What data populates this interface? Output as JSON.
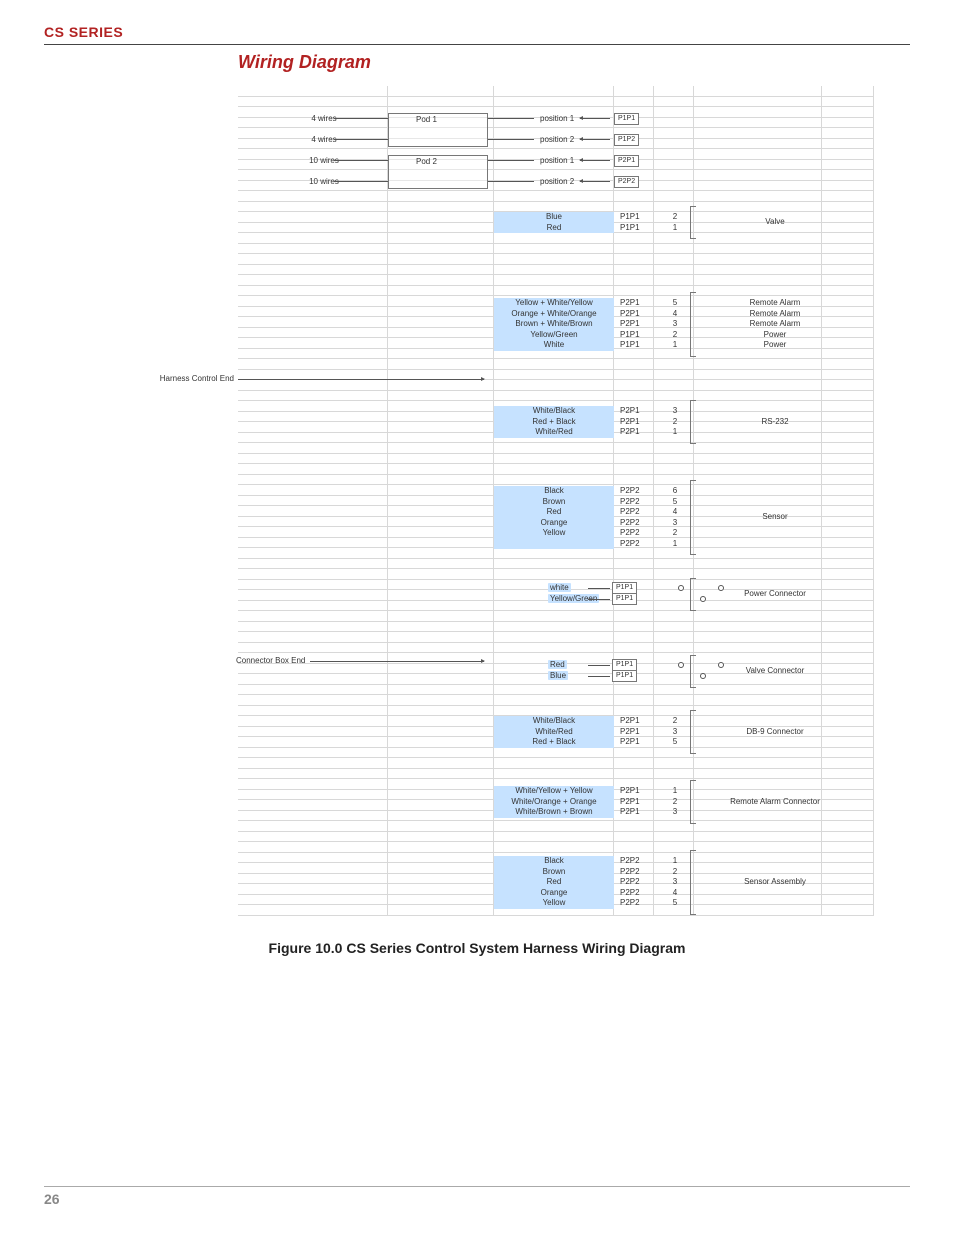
{
  "header": {
    "series": "CS SERIES"
  },
  "section_title": "Wiring Diagram",
  "caption": "Figure 10.0 CS Series Control System Harness Wiring Diagram",
  "page_number": "26",
  "pods": [
    {
      "wires": "4 wires",
      "pod": "Pod 1",
      "position": "position 1",
      "conn": "P1P1"
    },
    {
      "wires": "4 wires",
      "pod": "",
      "position": "position 2",
      "conn": "P1P2"
    },
    {
      "wires": "10 wires",
      "pod": "Pod 2",
      "position": "position 1",
      "conn": "P2P1"
    },
    {
      "wires": "10 wires",
      "pod": "",
      "position": "position 2",
      "conn": "P2P2"
    }
  ],
  "harness_label": "Harness Control End",
  "connector_box_label": "Connector Box End",
  "groups": [
    {
      "function": "Valve",
      "rows": [
        {
          "color": "Blue",
          "conn": "P1P1",
          "pin": "2"
        },
        {
          "color": "Red",
          "conn": "P1P1",
          "pin": "1"
        }
      ]
    },
    {
      "function_rows": [
        "Remote Alarm",
        "Remote Alarm",
        "Remote Alarm",
        "Power",
        "Power"
      ],
      "rows": [
        {
          "color": "Yellow + White/Yellow",
          "conn": "P2P1",
          "pin": "5"
        },
        {
          "color": "Orange + White/Orange",
          "conn": "P2P1",
          "pin": "4"
        },
        {
          "color": "Brown + White/Brown",
          "conn": "P2P1",
          "pin": "3"
        },
        {
          "color": "Yellow/Green",
          "conn": "P1P1",
          "pin": "2"
        },
        {
          "color": "White",
          "conn": "P1P1",
          "pin": "1"
        }
      ]
    },
    {
      "function": "RS-232",
      "rows": [
        {
          "color": "White/Black",
          "conn": "P2P1",
          "pin": "3"
        },
        {
          "color": "Red + Black",
          "conn": "P2P1",
          "pin": "2"
        },
        {
          "color": "White/Red",
          "conn": "P2P1",
          "pin": "1"
        }
      ]
    },
    {
      "function": "Sensor",
      "rows": [
        {
          "color": "Black",
          "conn": "P2P2",
          "pin": "6"
        },
        {
          "color": "Brown",
          "conn": "P2P2",
          "pin": "5"
        },
        {
          "color": "Red",
          "conn": "P2P2",
          "pin": "4"
        },
        {
          "color": "Orange",
          "conn": "P2P2",
          "pin": "3"
        },
        {
          "color": "Yellow",
          "conn": "P2P2",
          "pin": "2"
        },
        {
          "color": "",
          "conn": "P2P2",
          "pin": "1"
        }
      ]
    },
    {
      "function": "Power Connector",
      "is_connector": true,
      "rows": [
        {
          "color": "white",
          "conn": "P1P1"
        },
        {
          "color": "Yellow/Green",
          "conn": "P1P1"
        }
      ]
    },
    {
      "function": "Valve Connector",
      "is_connector": true,
      "rows": [
        {
          "color": "Red",
          "conn": "P1P1"
        },
        {
          "color": "Blue",
          "conn": "P1P1"
        }
      ]
    },
    {
      "function": "DB-9 Connector",
      "rows": [
        {
          "color": "White/Black",
          "conn": "P2P1",
          "pin": "2"
        },
        {
          "color": "White/Red",
          "conn": "P2P1",
          "pin": "3"
        },
        {
          "color": "Red + Black",
          "conn": "P2P1",
          "pin": "5"
        }
      ]
    },
    {
      "function": "Remote Alarm Connector",
      "rows": [
        {
          "color": "White/Yellow + Yellow",
          "conn": "P2P1",
          "pin": "1"
        },
        {
          "color": "White/Orange + Orange",
          "conn": "P2P1",
          "pin": "2"
        },
        {
          "color": "White/Brown + Brown",
          "conn": "P2P1",
          "pin": "3"
        }
      ]
    },
    {
      "function": "Sensor Assembly",
      "rows": [
        {
          "color": "Black",
          "conn": "P2P2",
          "pin": "1"
        },
        {
          "color": "Brown",
          "conn": "P2P2",
          "pin": "2"
        },
        {
          "color": "Red",
          "conn": "P2P2",
          "pin": "3"
        },
        {
          "color": "Orange",
          "conn": "P2P2",
          "pin": "4"
        },
        {
          "color": "Yellow",
          "conn": "P2P2",
          "pin": "5"
        }
      ]
    }
  ]
}
